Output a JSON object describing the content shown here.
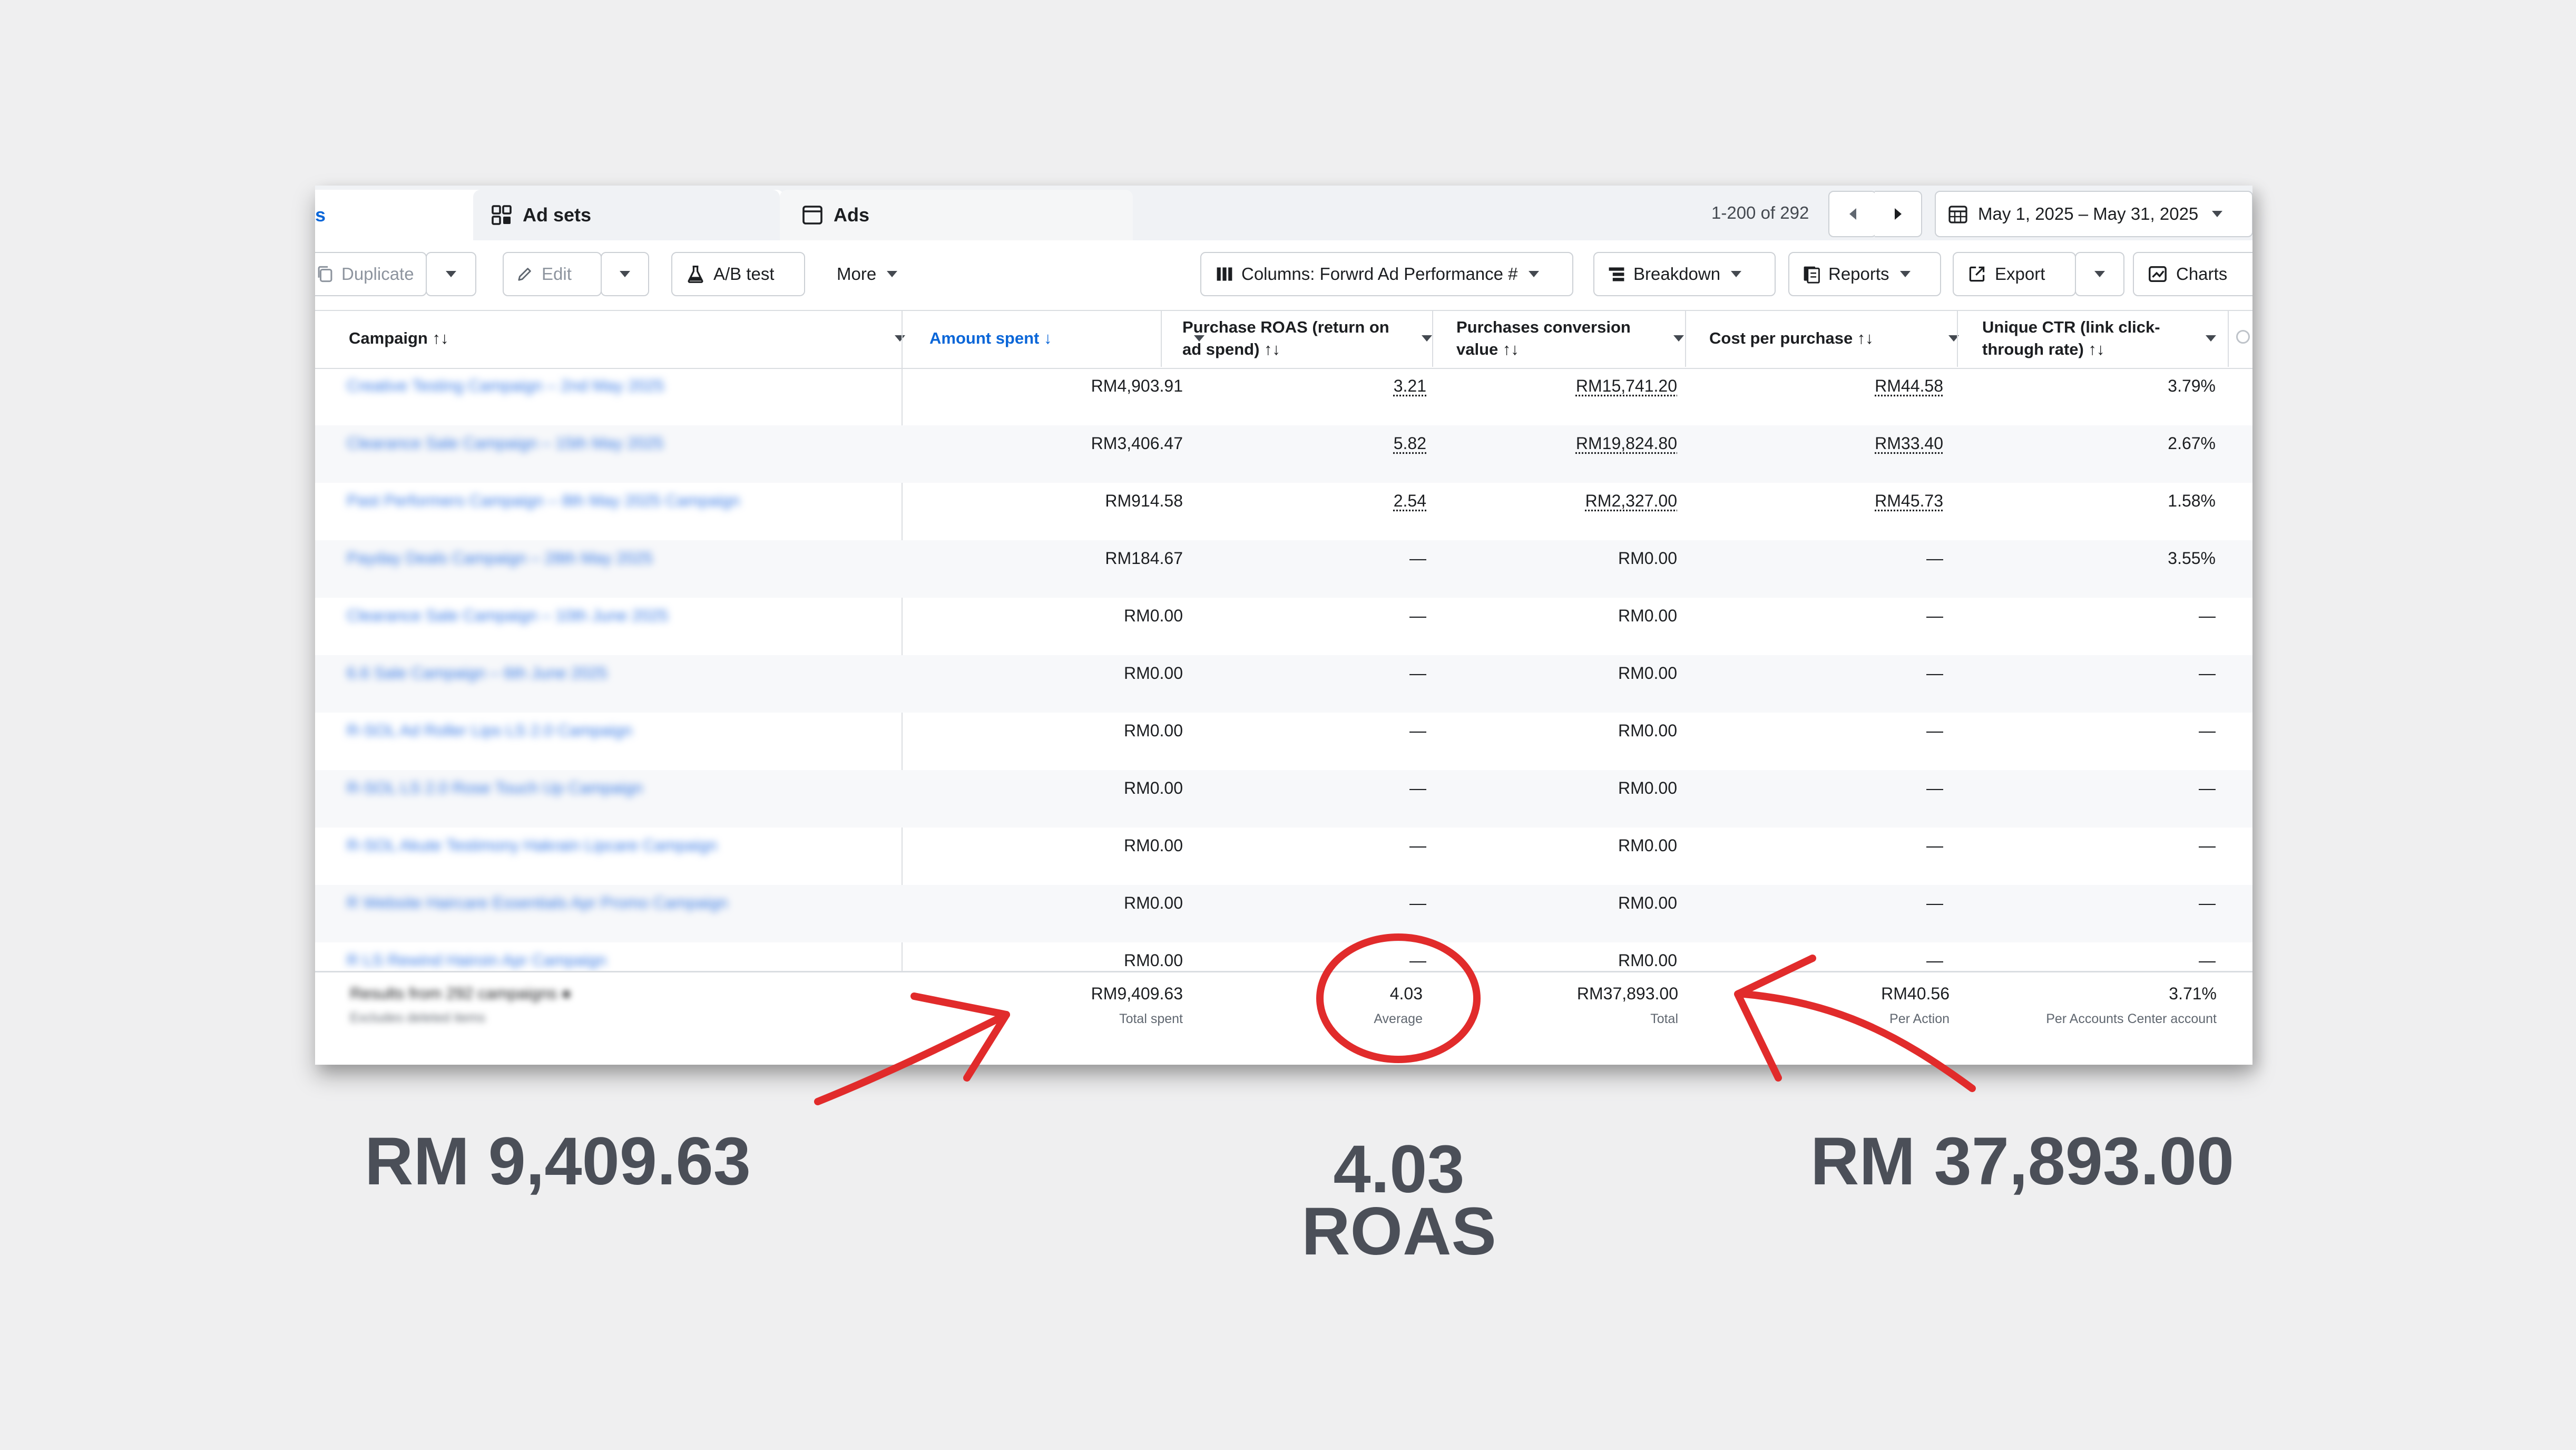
{
  "tabs": {
    "campaigns_partial": "s",
    "ad_sets": "Ad sets",
    "ads": "Ads"
  },
  "pager": {
    "range": "1-200 of 292"
  },
  "date_range": "May 1, 2025 – May 31, 2025",
  "toolbar": {
    "duplicate": "Duplicate",
    "edit": "Edit",
    "ab_test": "A/B test",
    "more": "More",
    "columns": "Columns: Forwrd Ad Performance #",
    "breakdown": "Breakdown",
    "reports": "Reports",
    "export": "Export",
    "charts": "Charts"
  },
  "table": {
    "headers": {
      "campaign": "Campaign ↑↓",
      "amount_spent": "Amount spent ↓",
      "roas_line1": "Purchase ROAS (return on",
      "roas_line2": "ad spend) ↑↓",
      "conv_line1": "Purchases conversion",
      "conv_line2": "value ↑↓",
      "cpp": "Cost per purchase ↑↓",
      "ctr_line1": "Unique CTR (link click-",
      "ctr_line2": "through rate) ↑↓"
    },
    "rows": [
      {
        "name": "Creative Testing Campaign – 2nd May 2025",
        "spent": "RM4,903.91",
        "roas": "3.21",
        "conv": "RM15,741.20",
        "cpp": "RM44.58",
        "ctr": "3.79%"
      },
      {
        "name": "Clearance Sale Campaign – 15th May 2025",
        "spent": "RM3,406.47",
        "roas": "5.82",
        "conv": "RM19,824.80",
        "cpp": "RM33.40",
        "ctr": "2.67%"
      },
      {
        "name": "Past Performers Campaign – 8th May 2025 Campaign",
        "spent": "RM914.58",
        "roas": "2.54",
        "conv": "RM2,327.00",
        "cpp": "RM45.73",
        "ctr": "1.58%"
      },
      {
        "name": "Payday Deals Campaign – 28th May 2025",
        "spent": "RM184.67",
        "roas": "—",
        "conv": "RM0.00",
        "cpp": "—",
        "ctr": "3.55%"
      },
      {
        "name": "Clearance Sale Campaign – 10th June 2025",
        "spent": "RM0.00",
        "roas": "—",
        "conv": "RM0.00",
        "cpp": "—",
        "ctr": "—"
      },
      {
        "name": "6.6 Sale Campaign – 6th June 2025",
        "spent": "RM0.00",
        "roas": "—",
        "conv": "RM0.00",
        "cpp": "—",
        "ctr": "—"
      },
      {
        "name": "R-SOL Ad Roller Lips LS 2.0 Campaign",
        "spent": "RM0.00",
        "roas": "—",
        "conv": "RM0.00",
        "cpp": "—",
        "ctr": "—"
      },
      {
        "name": "R-SOL LS 2.0 Rose Touch Up Campaign",
        "spent": "RM0.00",
        "roas": "—",
        "conv": "RM0.00",
        "cpp": "—",
        "ctr": "—"
      },
      {
        "name": "R-SOL Akute Testimony Hakrain Lipcare Campaign",
        "spent": "RM0.00",
        "roas": "—",
        "conv": "RM0.00",
        "cpp": "—",
        "ctr": "—"
      },
      {
        "name": "R Website Haircare Essentials Apr Promo Campaign",
        "spent": "RM0.00",
        "roas": "—",
        "conv": "RM0.00",
        "cpp": "—",
        "ctr": "—"
      },
      {
        "name": "R LS Rewind Hairoin Apr Campaign",
        "spent": "RM0.00",
        "roas": "—",
        "conv": "RM0.00",
        "cpp": "—",
        "ctr": "—"
      }
    ],
    "footer": {
      "results_label": "Results from 292 campaigns",
      "results_sub": "Excludes deleted items",
      "spent": "RM9,409.63",
      "spent_sub": "Total spent",
      "roas": "4.03",
      "roas_sub": "Average",
      "conv": "RM37,893.00",
      "conv_sub": "Total",
      "cpp": "RM40.56",
      "cpp_sub": "Per Action",
      "ctr": "3.71%",
      "ctr_sub": "Per Accounts Center account"
    }
  },
  "callouts": {
    "spent": "RM 9,409.63",
    "roas_value": "4.03",
    "roas_label": "ROAS",
    "conv": "RM 37,893.00"
  },
  "colors": {
    "accent_blue": "#0a66d8",
    "annotation_red": "#e12b2b",
    "callout_text": "#4b4f58"
  }
}
